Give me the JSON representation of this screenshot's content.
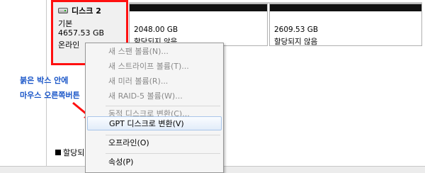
{
  "disk": {
    "name": "디스크 2",
    "type": "기본",
    "size": "4657.53 GB",
    "status": "온라인"
  },
  "partitions": [
    {
      "size": "2048.00 GB",
      "status": "할당되지 않음"
    },
    {
      "size": "2609.53 GB",
      "status": "할당되지 않음"
    }
  ],
  "context_menu": {
    "items": [
      {
        "label": "새 스팬 볼륨(N)...",
        "enabled": false
      },
      {
        "label": "새 스트라이프 볼륨(T)...",
        "enabled": false
      },
      {
        "label": "새 미러 볼륨(R)...",
        "enabled": false
      },
      {
        "label": "새 RAID-5 볼륨(W)...",
        "enabled": false
      },
      {
        "label": "동적 디스크로 변환(C)...",
        "enabled": false
      },
      {
        "label": "GPT 디스크로 변환(V)",
        "enabled": true,
        "highlighted": true
      },
      {
        "label": "오프라인(O)",
        "enabled": true
      },
      {
        "label": "속성(P)",
        "enabled": true
      }
    ]
  },
  "annotation": {
    "line1": "붉은 박스 안에",
    "line2": "마우스 오른쪽버튼"
  },
  "legend": {
    "label": "할당되"
  },
  "colors": {
    "highlight_box": "#ff1010",
    "annotation_text": "#1a56c8",
    "arrow": "#ff1010"
  }
}
